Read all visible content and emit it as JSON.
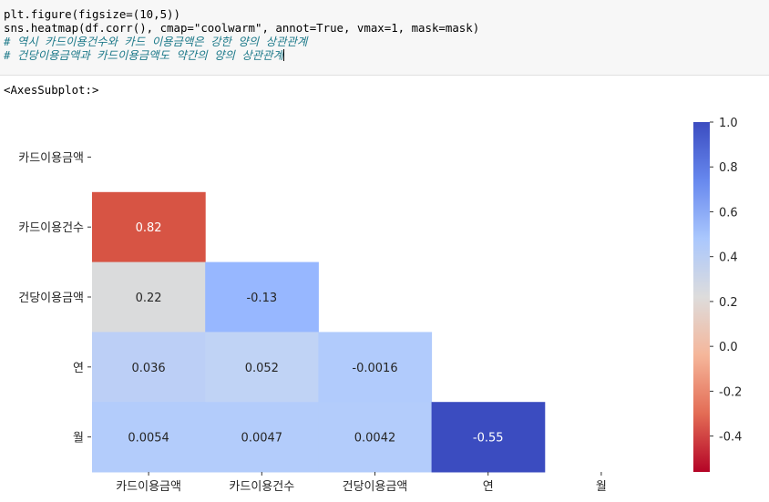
{
  "notebook": {
    "code_lines": [
      "plt.figure(figsize=(10,5))",
      "sns.heatmap(df.corr(), cmap=\"coolwarm\", annot=True, vmax=1, mask=mask)"
    ],
    "comment_lines": [
      "# 역시 카드이용건수와 카드 이용금액은 강한 양의 상관관계",
      "# 건당이용금액과 카드이용금액도 약간의 양의 상관관계"
    ],
    "output_text": "<AxesSubplot:>"
  },
  "chart_data": {
    "type": "heatmap",
    "title": "",
    "xlabel": "",
    "ylabel": "",
    "cmap": "coolwarm",
    "x_labels": [
      "카드이용금액",
      "카드이용건수",
      "건당이용금액",
      "연",
      "월"
    ],
    "y_labels": [
      "카드이용금액",
      "카드이용건수",
      "건당이용금액",
      "연",
      "월"
    ],
    "cells": [
      {
        "row": 1,
        "col": 0,
        "value": 0.82,
        "label": "0.82",
        "color": "#d75444"
      },
      {
        "row": 2,
        "col": 0,
        "value": 0.22,
        "label": "0.22",
        "color": "#dadbdc"
      },
      {
        "row": 2,
        "col": 1,
        "value": -0.13,
        "label": "-0.13",
        "color": "#97b7ff"
      },
      {
        "row": 3,
        "col": 0,
        "value": 0.036,
        "label": "0.036",
        "color": "#bccff6"
      },
      {
        "row": 3,
        "col": 1,
        "value": 0.052,
        "label": "0.052",
        "color": "#c0d3f5"
      },
      {
        "row": 3,
        "col": 2,
        "value": -0.0016,
        "label": "-0.0016",
        "color": "#b1cbfc"
      },
      {
        "row": 4,
        "col": 0,
        "value": 0.0054,
        "label": "0.0054",
        "color": "#b3ccfb"
      },
      {
        "row": 4,
        "col": 1,
        "value": 0.0047,
        "label": "0.0047",
        "color": "#b3ccfb"
      },
      {
        "row": 4,
        "col": 2,
        "value": 0.0042,
        "label": "0.0042",
        "color": "#b3ccfb"
      },
      {
        "row": 4,
        "col": 3,
        "value": -0.55,
        "label": "-0.55",
        "color": "#3b4cc0"
      }
    ],
    "colorbar": {
      "vmin": -0.56,
      "vmax": 1.0,
      "ticks": [
        1.0,
        0.8,
        0.6,
        0.4,
        0.2,
        0.0,
        -0.2,
        -0.4
      ],
      "tick_labels": [
        "1.0",
        "0.8",
        "0.6",
        "0.4",
        "0.2",
        "0.0",
        "-0.2",
        "-0.4"
      ],
      "colors": [
        "#b40426",
        "#e36c55",
        "#f5b69a",
        "#dddcdc",
        "#aac7fd",
        "#6788ee",
        "#3b4cc0"
      ]
    },
    "grid": false,
    "legend": "colorbar-right"
  }
}
